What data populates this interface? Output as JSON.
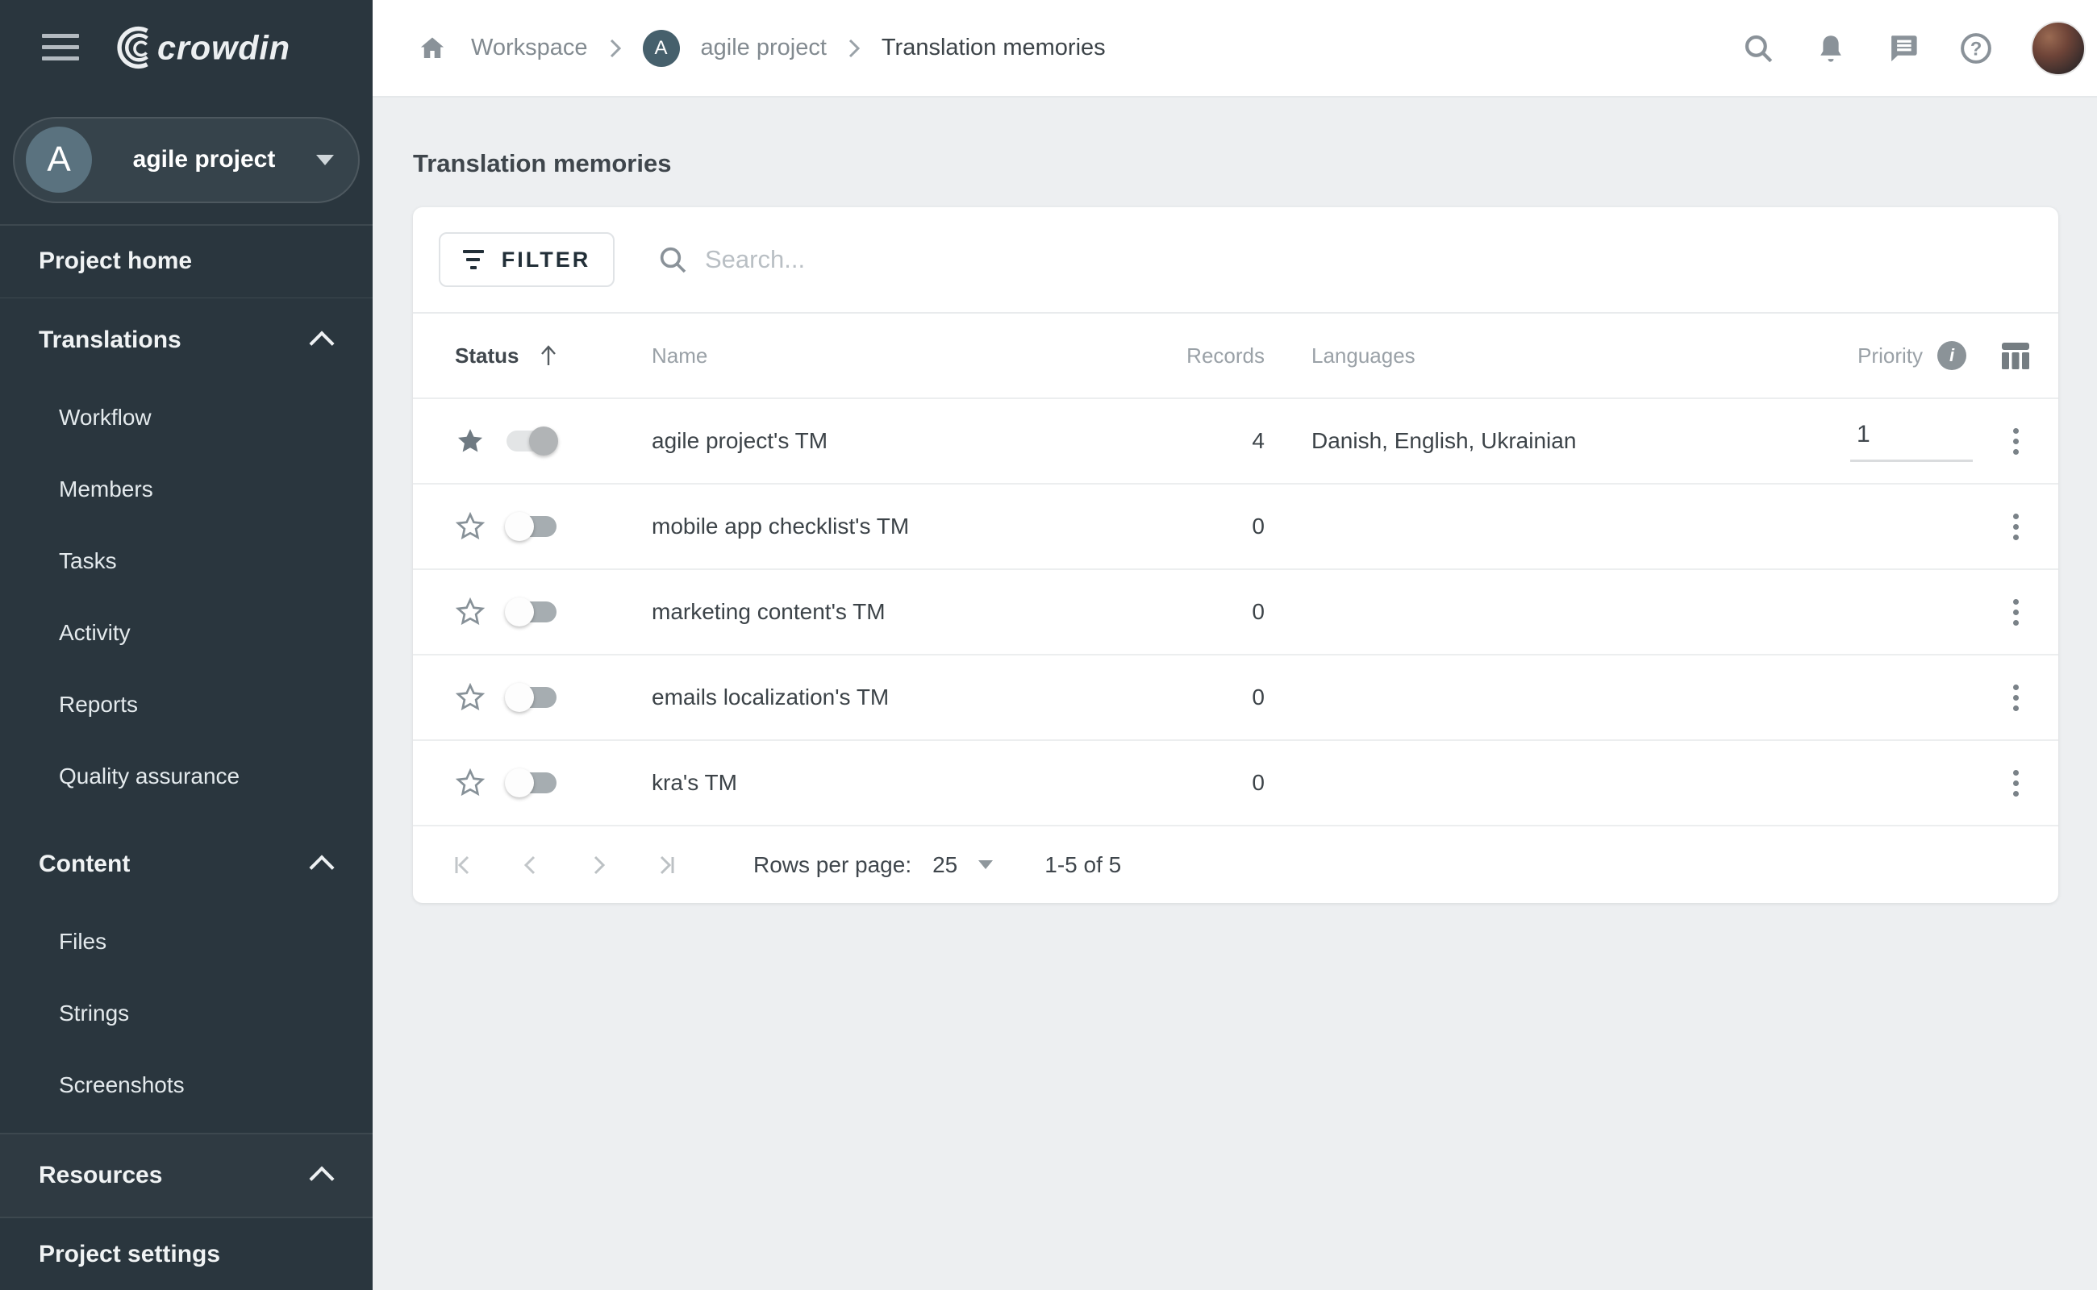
{
  "colors": {
    "sidebar_bg": "#2a363e",
    "pill_bg": "#36434b",
    "avatar_slate": "#5a727f",
    "main_bg": "#edeff1",
    "card_bg": "#ffffff",
    "text_dark": "#3c4348",
    "text_grey": "#9aa1a7",
    "icon_grey": "#8a9299"
  },
  "sidebar": {
    "logo_text": "crowdin",
    "project": {
      "initial": "A",
      "name": "agile project"
    },
    "project_home_label": "Project home",
    "sections": {
      "translations": {
        "label": "Translations",
        "items": [
          "Workflow",
          "Members",
          "Tasks",
          "Activity",
          "Reports",
          "Quality assurance"
        ]
      },
      "content": {
        "label": "Content",
        "items": [
          "Files",
          "Strings",
          "Screenshots"
        ]
      },
      "resources": {
        "label": "Resources"
      }
    },
    "project_settings_label": "Project settings"
  },
  "topbar": {
    "breadcrumb": {
      "workspace": "Workspace",
      "project_initial": "A",
      "project": "agile project",
      "current": "Translation memories"
    },
    "icons": {
      "search": "magnifier",
      "notifications": "bell",
      "messages": "chat-bubble",
      "help": "question-circle",
      "avatar": "user-photo"
    }
  },
  "main": {
    "title": "Translation memories",
    "toolbar": {
      "filter_label": "FILTER",
      "search_placeholder": "Search..."
    },
    "table": {
      "columns": {
        "status": "Status",
        "name": "Name",
        "records": "Records",
        "languages": "Languages",
        "priority": "Priority"
      },
      "rows": [
        {
          "starred": true,
          "enabled": true,
          "name": "agile project's TM",
          "records": "4",
          "languages": "Danish, English, Ukrainian",
          "priority": "1"
        },
        {
          "starred": false,
          "enabled": false,
          "name": "mobile app checklist's TM",
          "records": "0",
          "languages": "",
          "priority": ""
        },
        {
          "starred": false,
          "enabled": false,
          "name": "marketing content's TM",
          "records": "0",
          "languages": "",
          "priority": ""
        },
        {
          "starred": false,
          "enabled": false,
          "name": "emails localization's TM",
          "records": "0",
          "languages": "",
          "priority": ""
        },
        {
          "starred": false,
          "enabled": false,
          "name": "kra's TM",
          "records": "0",
          "languages": "",
          "priority": ""
        }
      ]
    },
    "pagination": {
      "rows_per_page_label": "Rows per page:",
      "rows_per_page_value": "25",
      "range": "1-5 of 5"
    }
  }
}
